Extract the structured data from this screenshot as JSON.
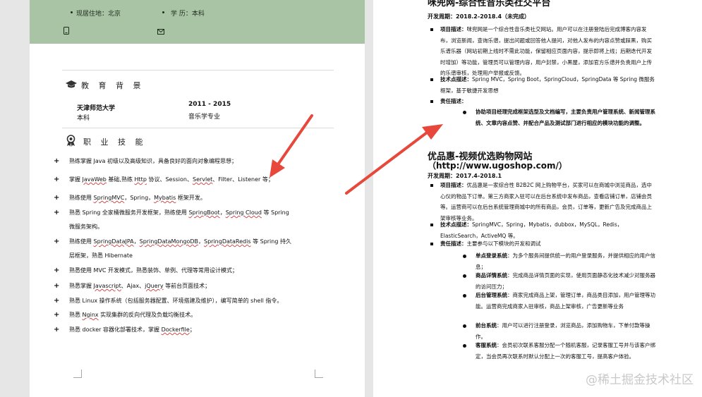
{
  "left_page": {
    "header": {
      "location": "现居住地：北京",
      "education": "学        历：本科"
    },
    "education_section": {
      "title": "教 育 背 景",
      "school": "天津师范大学",
      "years": "2011 - 2015",
      "degree": "本科",
      "major": "音乐学专业"
    },
    "skills_section": {
      "title": "职 业 技 能",
      "items": [
        [
          "熟练掌握 Java 初级以及高级知识，具备良好的面向对象编程思想；"
        ],
        [
          "掌握 ",
          {
            "u": "JavaWeb"
          },
          " 基础,熟练 ",
          {
            "u": "Http"
          },
          " 协议、Session、",
          {
            "u": "Servlet"
          },
          "、Filter、Listener 等；"
        ],
        [
          "熟练使用 ",
          {
            "u": "SpringMVC"
          },
          "，Spring，",
          {
            "u": "Mybatis"
          },
          " 框架开发。"
        ],
        [
          "熟悉 Spring 全家桶微服务开发框架，熟练使用 ",
          {
            "u": "SpringBoot"
          },
          "，",
          {
            "u": "Spring Cloud"
          },
          " 等 Spring\n微服务架构。"
        ],
        [
          "熟练使用 ",
          {
            "u": "SpringDataJPA"
          },
          "，",
          {
            "u": "SpringDataMongoDB"
          },
          "，",
          {
            "u": "SpringDataRedis"
          },
          " 等 Spring 持久\n层框架，熟悉 Hibernate"
        ],
        [
          "熟悉使用 MVC 开发模式，熟悉装饰、单例、代理等常用设计模式；"
        ],
        [
          "熟悉掌握 ",
          {
            "u": "Javascript"
          },
          "、Ajax、",
          {
            "u": "jQuery"
          },
          " 等前台页面技术；"
        ],
        [
          "熟悉 Linux 操作系统（包括服务器配置、环境搭建及维护），编写简单的 shell 指令。"
        ],
        [
          "熟悉 ",
          {
            "u": "Nginx"
          },
          " 实现集群的反向代理及负载均衡技术。"
        ],
        [
          "熟悉 docker 容器化部署技术，掌握 ",
          {
            "u": "Dockerfile"
          },
          "；"
        ]
      ]
    }
  },
  "right_page": {
    "project1": {
      "title": "咪兜网-综合性音乐类社交平台",
      "period": "开发周期：2018.2-2018.4（未完成）",
      "desc_label": "项目描述：",
      "desc": "咪兜网是一个综合性音乐类社交网站。用户可以在注册登陆后完成博客内容发布，浏览新闻，查询乐谱，提出问题或回答他人提问，对他人发布的内容点赞或踩黑，购买乐谱乐器（网站初期上线时不需此功能，保留相应页面内容，提示即将上线；后期迭代开发时增加）等功能，管理员可以管理内容，用户封禁，小黑屋，添加官方乐谱并负责用户上传的乐谱审核，处理用户举报或反馈。",
      "tech_label": "技术点描述：",
      "tech": "Spring MVC，Spring Boot，SpringCloud，SpringData 等 Spring 微服务框架，基于敏捷开发思想",
      "resp_label": "责任描述：",
      "resp": "协助项目经理完成框架选型及文档编写，主要负责用户管理系统、新闻管理系统、文章内容点赞、并配合产品及测试部门进行相应的模块功能的调整。"
    },
    "project2": {
      "title": "优品惠-视频优选购物网站",
      "url": "（http://www.ugoshop.com/）",
      "period": "开发周期：2017.4-2018.1",
      "desc_label": "项目描述：",
      "desc": "优品惠是一家综合性 B2B2C 网上购物平台，买家可以在商城中浏览商品，选中心仪的物品下订单。第三方商家入驻可以在后台系统中发布商品，查看店铺订单，店铺会员等。运营商可以在后台系统管理商城中的所有商品，会员，订单等，更新广告及完成商品上架审核等业务。",
      "tech_label": "技术点描述：",
      "tech": "SpringMVC，Spring，Mybatis，dubbox，MySQL，Redis，ElasticSearch，ActiveMQ 等。",
      "resp_label": "责任描述：",
      "resp": "主要参与以下模块的开发和调试",
      "modules": [
        {
          "label": "单点登录系统",
          "text": "：为多个服务间提供统一的用户登录服务，并提供相应的用户信息；"
        },
        {
          "label": "商品详情系统",
          "text": "：完成商品详情页面的实现，使用页面静态化技术减少对服务器的访问压力；"
        },
        {
          "label": "后台管理系统",
          "text": "：商家完成商品上架，管理订单，商品类目添加，用户管理等功能。运营商完成商家入驻审核，商品上架审核，广告更新等业务"
        },
        {
          "label": "前台系统",
          "text": "：用户可以进行注册登录，浏览商品，添加购物车，下单付款等操作。"
        },
        {
          "label": "客服系统",
          "text": "：会员初次联系客服分配一个随机客服，记录客服工号并与该客户绑定，当会员再次联系时默认分配上一次的客服工号，提高客户体验。"
        }
      ]
    }
  },
  "watermark": "@稀土掘金技术社区",
  "colors": {
    "header_band": "#a9c4a5",
    "arrow": "#e8483b",
    "gutter": "#e6e6e6"
  }
}
